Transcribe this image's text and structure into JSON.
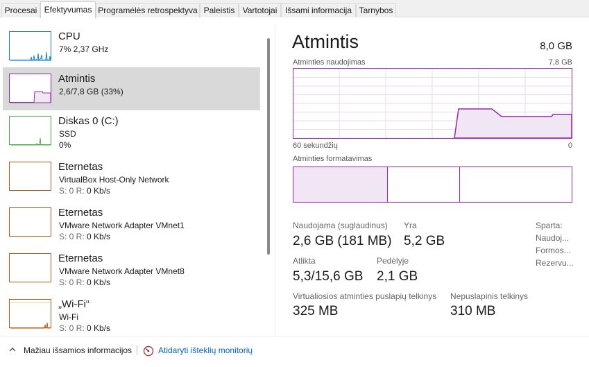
{
  "tabs": [
    "Procesai",
    "Efektyvumas",
    "Programėlės retrospektyva",
    "Paleistis",
    "Vartotojai",
    "Išsami informacija",
    "Tarnybos"
  ],
  "active_tab": "Efektyvumas",
  "resources": [
    {
      "name": "CPU",
      "line1": "7% 2,37 GHz",
      "line2": "",
      "color": "#1a82c4"
    },
    {
      "name": "Atmintis",
      "line1": "2,6/7,8 GB (33%)",
      "line2": "",
      "color": "#9528b4"
    },
    {
      "name": "Diskas 0 (C:)",
      "line1": "SSD",
      "line2": "0%",
      "color": "#4ca64c"
    },
    {
      "name": "Eternetas",
      "line1": "VirtualBox Host-Only Network",
      "line2_prefix": "S: 0 R:",
      "line2_value": "0 Kb/s",
      "color": "#a75d1a"
    },
    {
      "name": "Eternetas",
      "line1": "VMware Network Adapter VMnet1",
      "line2_prefix": "S: 0 R:",
      "line2_value": "0 Kb/s",
      "color": "#a75d1a"
    },
    {
      "name": "Eternetas",
      "line1": "VMware Network Adapter VMnet8",
      "line2_prefix": "S: 0 R:",
      "line2_value": "0 Kb/s",
      "color": "#a75d1a"
    },
    {
      "name": "„Wi-Fi“",
      "line1": "Wi-Fi",
      "line2_prefix": "S: 0 R:",
      "line2_value": "0 Kb/s",
      "color": "#a75d1a"
    }
  ],
  "detail": {
    "title": "Atmintis",
    "total": "8,0 GB",
    "usage_label": "Atminties naudojimas",
    "usage_max": "7,8 GB",
    "time_left": "60 sekundžių",
    "time_right": "0",
    "composition_label": "Atminties formatavimas",
    "stats": {
      "in_use_label": "Naudojama (suglaudinus)",
      "in_use_value": "2,6 GB (181 MB)",
      "available_label": "Yra",
      "available_value": "5,2 GB",
      "committed_label": "Atlikta",
      "committed_value": "5,3/15,6 GB",
      "shared_label": "Pedėlyje",
      "shared_value": "2,1 GB",
      "paged_label": "Virtualiosios atminties puslapių telkinys",
      "paged_value": "325 MB",
      "nonpaged_label": "Nepuslapinis telkinys",
      "nonpaged_value": "310 MB"
    },
    "side_labels": [
      "Sparta:",
      "Naudoj...",
      "Formos...",
      "Rezervu..."
    ],
    "composition": [
      0.34,
      0.26,
      0.4
    ]
  },
  "footer": {
    "fewer_details": "Mažiau išsamios informacijos",
    "open_monitor": "Atidaryti išteklių monitorių"
  },
  "colors": {
    "memory": "#9528b4",
    "cpu": "#1a82c4",
    "disk": "#4ca64c",
    "network": "#a75d1a",
    "link": "#0066cc"
  }
}
